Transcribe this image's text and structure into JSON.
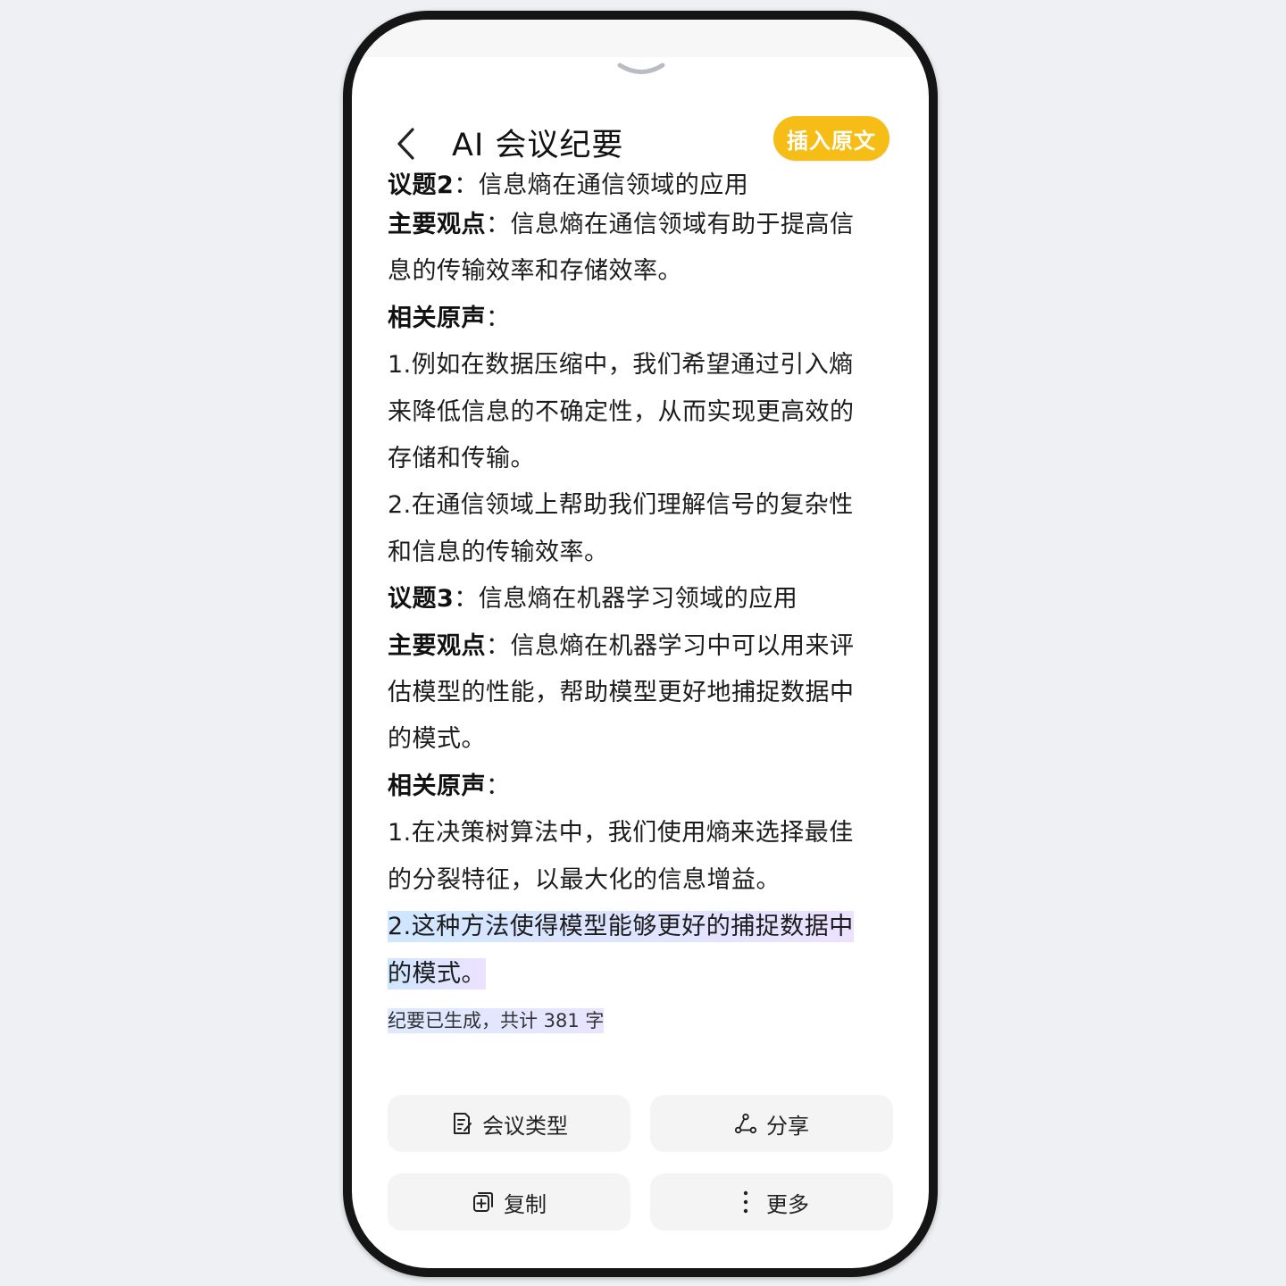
{
  "header": {
    "title": "AI 会议纪要",
    "insert_label": "插入原文"
  },
  "lines": [
    {
      "bold": "议题2",
      "text": "：信息熵在通信领域的应用"
    },
    {
      "bold": "主要观点",
      "text": "：信息熵在通信领域有助于提高信"
    },
    {
      "bold": "",
      "text": "息的传输效率和存储效率。"
    },
    {
      "bold": "相关原声",
      "text": "："
    },
    {
      "bold": "",
      "text": "1.例如在数据压缩中，我们希望通过引入熵"
    },
    {
      "bold": "",
      "text": "来降低信息的不确定性，从而实现更高效的"
    },
    {
      "bold": "",
      "text": "存储和传输。"
    },
    {
      "bold": "",
      "text": "2.在通信领域上帮助我们理解信号的复杂性"
    },
    {
      "bold": "",
      "text": "和信息的传输效率。"
    },
    {
      "bold": "议题3",
      "text": "：信息熵在机器学习领域的应用"
    },
    {
      "bold": "主要观点",
      "text": "：信息熵在机器学习中可以用来评"
    },
    {
      "bold": "",
      "text": "估模型的性能，帮助模型更好地捕捉数据中"
    },
    {
      "bold": "",
      "text": "的模式。"
    },
    {
      "bold": "相关原声",
      "text": "："
    },
    {
      "bold": "",
      "text": "1.在决策树算法中，我们使用熵来选择最佳"
    },
    {
      "bold": "",
      "text": "的分裂特征，以最大化的信息增益。"
    }
  ],
  "highlighted": [
    "2.这种方法使得模型能够更好的捕捉数据中",
    "的模式。"
  ],
  "status": "纪要已生成，共计 381 字",
  "actions": {
    "meeting_type": "会议类型",
    "share": "分享",
    "copy": "复制",
    "more": "更多"
  },
  "icons": {
    "back": "chevron-left-icon",
    "handle": "chevron-down-icon",
    "meeting_type": "document-edit-icon",
    "share": "share-icon",
    "copy": "copy-icon",
    "more": "vertical-dots-icon"
  },
  "colors": {
    "accent": "#f6bd17",
    "button_bg": "#f4f4f5",
    "highlight": "#cfe6ff"
  }
}
